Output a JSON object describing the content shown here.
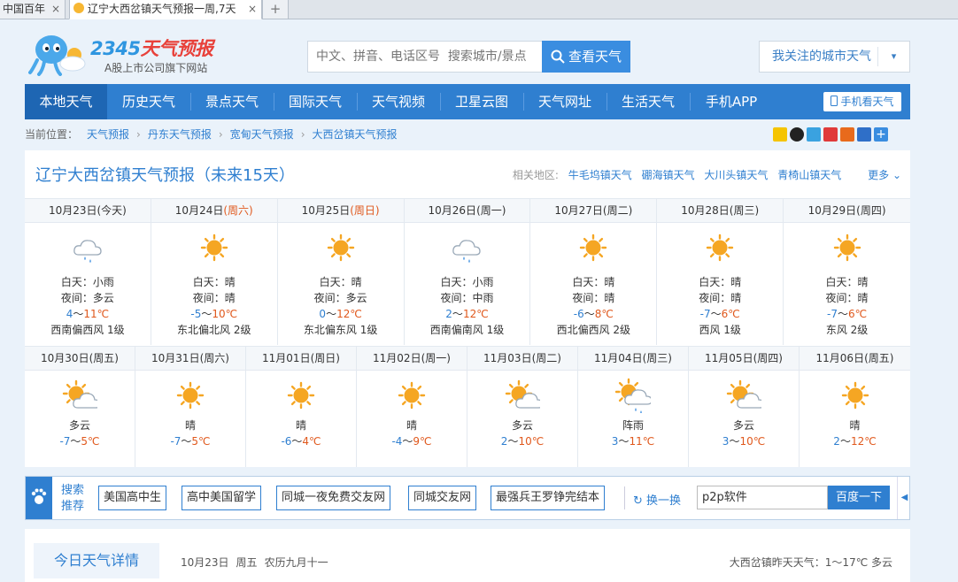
{
  "browser": {
    "tabs": [
      {
        "title": "中国百年",
        "active": false
      },
      {
        "title": "辽宁大西岔镇天气预报一周,7天",
        "active": true
      }
    ],
    "close_glyph": "×",
    "new_tab_glyph": "+"
  },
  "header": {
    "logo_brand_num": "2345",
    "logo_brand_text": "天气预报",
    "logo_tagline": "A股上市公司旗下网站",
    "search_placeholder": "中文、拼音、电话区号  搜索城市/景点",
    "search_button": "查看天气",
    "follow_button": "我关注的城市天气",
    "follow_icon": "chevron-down-icon"
  },
  "nav": {
    "items": [
      "本地天气",
      "历史天气",
      "景点天气",
      "国际天气",
      "天气视频",
      "卫星云图",
      "天气网址",
      "生活天气",
      "手机APP"
    ],
    "active_index": 0,
    "mobile_button": "手机看天气"
  },
  "breadcrumb": {
    "prefix": "当前位置：",
    "items": [
      "天气预报",
      "丹东天气预报",
      "宽甸天气预报",
      "大西岔镇天气预报"
    ],
    "separator": "›"
  },
  "share_icons": [
    "qzone-icon",
    "qq-icon",
    "pengyou-icon",
    "weibo-icon",
    "renren-icon",
    "baidu-icon",
    "more-share-icon"
  ],
  "forecast": {
    "title": "辽宁大西岔镇天气预报（未来15天）",
    "related_label": "相关地区:",
    "related": [
      "牛毛坞镇天气",
      "硼海镇天气",
      "大川头镇天气",
      "青椅山镇天气"
    ],
    "more_label": "更多",
    "week1": [
      {
        "date": "10月23日",
        "week": "(今天)",
        "weekend": false,
        "icon": "rain-icon",
        "day": "白天：小雨",
        "night": "夜间：多云",
        "low": "4",
        "high": "11℃",
        "wind": "西南偏西风  1级"
      },
      {
        "date": "10月24日",
        "week": "(周六)",
        "weekend": true,
        "icon": "sunny-icon",
        "day": "白天：晴",
        "night": "夜间：晴",
        "low": "-5",
        "high": "10℃",
        "wind": "东北偏北风  2级"
      },
      {
        "date": "10月25日",
        "week": "(周日)",
        "weekend": true,
        "icon": "sunny-icon",
        "day": "白天：晴",
        "night": "夜间：多云",
        "low": "0",
        "high": "12℃",
        "wind": "东北偏东风  1级"
      },
      {
        "date": "10月26日",
        "week": "(周一)",
        "weekend": false,
        "icon": "rain-icon",
        "day": "白天：小雨",
        "night": "夜间：中雨",
        "low": "2",
        "high": "12℃",
        "wind": "西南偏南风  1级"
      },
      {
        "date": "10月27日",
        "week": "(周二)",
        "weekend": false,
        "icon": "sunny-icon",
        "day": "白天：晴",
        "night": "夜间：晴",
        "low": "-6",
        "high": "8℃",
        "wind": "西北偏西风  2级"
      },
      {
        "date": "10月28日",
        "week": "(周三)",
        "weekend": false,
        "icon": "sunny-icon",
        "day": "白天：晴",
        "night": "夜间：晴",
        "low": "-7",
        "high": "6℃",
        "wind": "西风  1级"
      },
      {
        "date": "10月29日",
        "week": "(周四)",
        "weekend": false,
        "icon": "sunny-icon",
        "day": "白天：晴",
        "night": "夜间：晴",
        "low": "-7",
        "high": "6℃",
        "wind": "东风  2级"
      }
    ],
    "week2": [
      {
        "date": "10月30日",
        "week": "(周五)",
        "icon": "partly-cloudy-icon",
        "cond": "多云",
        "low": "-7",
        "high": "5℃"
      },
      {
        "date": "10月31日",
        "week": "(周六)",
        "icon": "sunny-icon",
        "cond": "晴",
        "low": "-7",
        "high": "5℃"
      },
      {
        "date": "11月01日",
        "week": "(周日)",
        "icon": "sunny-icon",
        "cond": "晴",
        "low": "-6",
        "high": "4℃"
      },
      {
        "date": "11月02日",
        "week": "(周一)",
        "icon": "sunny-icon",
        "cond": "晴",
        "low": "-4",
        "high": "9℃"
      },
      {
        "date": "11月03日",
        "week": "(周二)",
        "icon": "partly-cloudy-icon",
        "cond": "多云",
        "low": "2",
        "high": "10℃"
      },
      {
        "date": "11月04日",
        "week": "(周三)",
        "icon": "shower-icon",
        "cond": "阵雨",
        "low": "3",
        "high": "11℃"
      },
      {
        "date": "11月05日",
        "week": "(周四)",
        "icon": "partly-cloudy-icon",
        "cond": "多云",
        "low": "3",
        "high": "10℃"
      },
      {
        "date": "11月06日",
        "week": "(周五)",
        "icon": "sunny-icon",
        "cond": "晴",
        "low": "2",
        "high": "12℃"
      }
    ],
    "tilde": "～"
  },
  "hot_search": {
    "label": "搜索推荐",
    "chips": [
      "美国高中生",
      "高中美国留学",
      "同城一夜免费交友网",
      "同城交友网",
      "最强兵王罗铮完结本"
    ],
    "swap_label": "换一换",
    "input_value": "p2p软件",
    "baidu_button": "百度一下"
  },
  "today_detail": {
    "tab_label": "今日天气详情",
    "date": "10月23日",
    "weekday": "周五",
    "lunar": "农历九月十一",
    "yesterday": "大西岔镇昨天天气：1～17℃  多云"
  },
  "colors": {
    "primary": "#2f7fd0",
    "nav_active": "#1e66b3",
    "weekend": "#e0581c",
    "low_temp": "#2f7fd0",
    "high_temp": "#e0581c",
    "sun": "#f5a623"
  }
}
